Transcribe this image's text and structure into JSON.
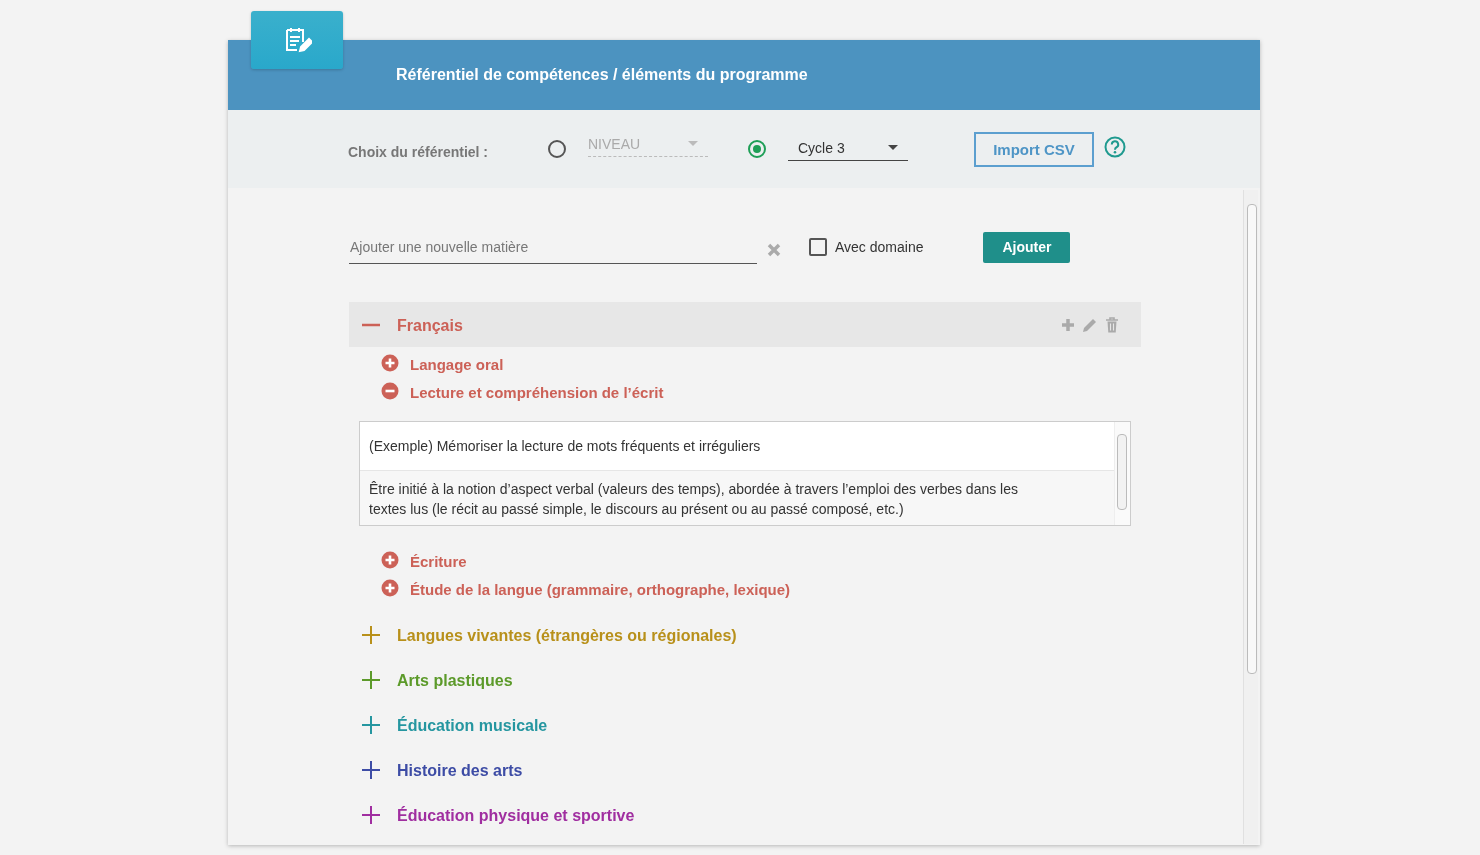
{
  "header": {
    "title": "Référentiel de compétences / éléments du programme"
  },
  "referentiel": {
    "label": "Choix du référentiel :",
    "options": [
      {
        "value": "NIVEAU",
        "selected": false,
        "disabled": true
      },
      {
        "value": "Cycle 3",
        "selected": true,
        "disabled": false
      }
    ]
  },
  "import_button": "Import CSV",
  "new_subject": {
    "placeholder": "Ajouter une nouvelle matière",
    "with_domain": {
      "label": "Avec domaine",
      "checked": false
    },
    "add_button": "Ajouter"
  },
  "subjects": [
    {
      "name": "Français",
      "color": "#cc6157",
      "expanded": true,
      "selected": true,
      "domains": [
        {
          "name": "Langage oral",
          "expanded": false
        },
        {
          "name": "Lecture et compréhension de l’écrit",
          "expanded": true,
          "items": [
            "(Exemple) Mémoriser la lecture de mots fréquents et irréguliers",
            "Être initié à la notion d’aspect verbal (valeurs des temps), abordée à travers l’emploi des verbes dans les textes lus (le récit au passé simple, le discours au présent ou au passé composé, etc.)"
          ]
        },
        {
          "name": "Écriture",
          "expanded": false
        },
        {
          "name": "Étude de la langue (grammaire, orthographe, lexique)",
          "expanded": false
        }
      ]
    },
    {
      "name": "Langues vivantes (étrangères ou régionales)",
      "color": "#b8901a",
      "expanded": false,
      "selected": false
    },
    {
      "name": "Arts plastiques",
      "color": "#5c9a2a",
      "expanded": false,
      "selected": false
    },
    {
      "name": "Éducation musicale",
      "color": "#2596a0",
      "expanded": false,
      "selected": false
    },
    {
      "name": "Histoire des arts",
      "color": "#3d4ca5",
      "expanded": false,
      "selected": false
    },
    {
      "name": "Éducation physique et sportive",
      "color": "#a02ea0",
      "expanded": false,
      "selected": false
    }
  ]
}
